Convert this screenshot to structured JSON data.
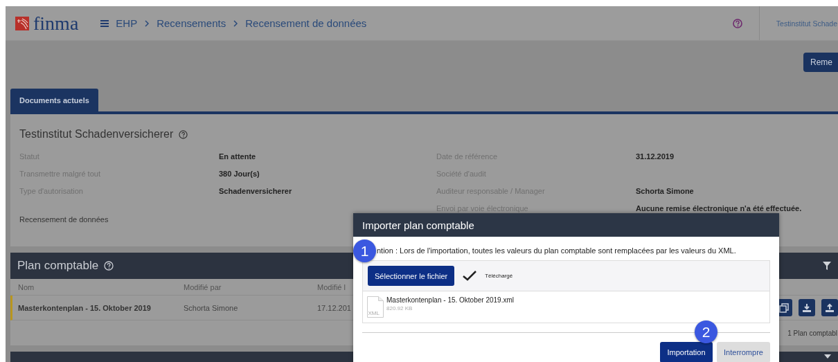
{
  "header": {
    "logo": "finma",
    "breadcrumb": [
      {
        "label": "EHP"
      },
      {
        "label": "Recensements"
      },
      {
        "label": "Recensement de données"
      }
    ],
    "user": "Testinstitut Schade"
  },
  "toolbar": {
    "button": "Reme"
  },
  "tabs": [
    {
      "label": "Documents actuels",
      "selected": true
    }
  ],
  "record": {
    "title": "Testinstitut Schadenversicherer",
    "left": [
      {
        "label": "Statut",
        "value": "En attente"
      },
      {
        "label": "Transmettre malgré tout",
        "value": "380 Jour(s)"
      },
      {
        "label": "Type d'autorisation",
        "value": "Schadenversicherer"
      }
    ],
    "right": [
      {
        "label": "Date de référence",
        "value": "31.12.2019"
      },
      {
        "label": "Société d'audit"
      },
      {
        "label": "Auditeur responsable / Manager",
        "value": "Schorta Simone"
      },
      {
        "label": "Envoi par voie électronique",
        "value": "Aucune remise électronique n'a été effectuée."
      }
    ],
    "section": "Recensement de données"
  },
  "plan": {
    "title": "Plan comptable",
    "columns": [
      "Nom",
      "Modifié par",
      "Modifié l"
    ],
    "rows": [
      {
        "cells": [
          "Masterkontenplan - 15. Oktober 2019",
          "Schorta Simone",
          "17.12.201"
        ]
      }
    ],
    "footer": "1 Plan comptabl"
  },
  "dialog": {
    "title": "Importer plan comptable",
    "message": "ntion : Lors de l'importation, toutes les valeurs du plan comptable sont remplacées par les valeurs du XML.",
    "select_button": "Sélectionner le fichier",
    "status": "Téléchargé",
    "file": {
      "name": "Masterkontenplan - 15. Oktober 2019.xml",
      "size": "820.92 KB",
      "type": "XML"
    },
    "buttons": [
      {
        "label": "Importation",
        "kind": "primary"
      },
      {
        "label": "Interrompre",
        "kind": "secondary"
      }
    ],
    "markers": [
      "1",
      "2"
    ]
  }
}
